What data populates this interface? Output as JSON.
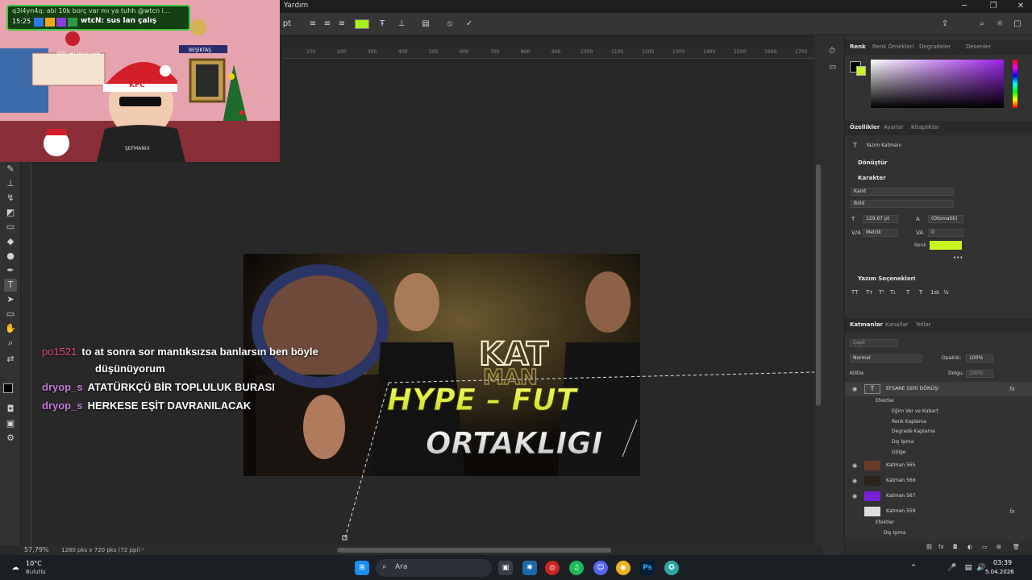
{
  "menubar": {
    "help_label": "Yardım"
  },
  "options_bar": {
    "unit": "pt",
    "text_color": "#a8f01a"
  },
  "webcam_overlay": {
    "chat_top_line1": "q3l4yn4q: abi 10k borç var mı ya tuhh @wtcn i...",
    "chat_top_time": "15:25",
    "chat_top_line2": "wtcN: sus lan çalış",
    "sign_text": "BEŞİKTAŞ",
    "hat_text": "KFC",
    "small_text": "4656 sen kimsin yaze",
    "shirt_text": "ŞEFMANIX"
  },
  "chat_overlay": [
    {
      "user": "po1521",
      "text": "to at sonra sor mantıksızsa banlarsın ben böyle",
      "cont": "düşünüyorum"
    },
    {
      "user": "dryop_s",
      "text": "ATATÜRKÇÜ BİR TOPLULUK BURASI"
    },
    {
      "user": "dryop_s",
      "text": "HERKESE EŞİT DAVRANILACAK"
    }
  ],
  "document": {
    "line1": "HYPE – FUT",
    "line2": "ORTAKLIGI",
    "neon_text": "KAT",
    "neon_text2": "MAN"
  },
  "ruler": {
    "ticks": [
      "100",
      "200",
      "300",
      "400",
      "500",
      "600",
      "700",
      "800",
      "900",
      "1000",
      "1100",
      "1200",
      "1300",
      "1400",
      "1500",
      "1600",
      "1700"
    ]
  },
  "status_bar": {
    "zoom": "57,79%",
    "doc_size": "1280 pks x 720 pks (72 ppi)"
  },
  "color_panel": {
    "tabs": [
      "Renk",
      "Renk Örnekleri",
      "Degradeler",
      "Desenler"
    ],
    "active_tab": "Renk"
  },
  "properties_panel": {
    "tabs": [
      "Özellikler",
      "Ayarlar",
      "Kitaplıklar"
    ],
    "layer_type": "Yazım Katmanı",
    "section_transform": "Dönüştür",
    "section_character": "Karakter",
    "font_family": "Kanit",
    "font_style": "Bold",
    "font_size": "129,67 pt",
    "leading": "(Otomatik)",
    "kerning": "Metrik",
    "tracking": "0",
    "color_label": "Renk",
    "color_value": "#c8f520",
    "section_typography": "Yazım Seçenekleri",
    "type_buttons": [
      "TT",
      "Tт",
      "T¹",
      "T₁",
      "T",
      "Ŧ",
      "1st",
      "½"
    ]
  },
  "layers_panel": {
    "tabs": [
      "Katmanlar",
      "Kanallar",
      "Yollar"
    ],
    "search_placeholder": "Çeşit",
    "blend_mode": "Normal",
    "opacity_label": "Opaklık:",
    "opacity_value": "100%",
    "lock_label": "Kilitle:",
    "fill_label": "Dolgu:",
    "fill_value": "100%",
    "layers": [
      {
        "name": "EFSANE GERİ DÖNÜŞ!",
        "type": "text",
        "fx": true,
        "visible": true
      },
      {
        "name": "Katman 565",
        "type": "image",
        "fx": false,
        "visible": true
      },
      {
        "name": "Katman 566",
        "type": "image",
        "fx": false,
        "visible": true
      },
      {
        "name": "Katman 567",
        "type": "image",
        "fx": false,
        "visible": true
      },
      {
        "name": "Katman 559",
        "type": "image",
        "fx": true,
        "visible": false
      }
    ],
    "effects_label": "Efektler",
    "effects1": [
      "Eğim Ver ve Kabart",
      "Renk Kaplama",
      "Degrade Kaplama",
      "Dış Işıma",
      "Gölge"
    ],
    "effects2": [
      "Dış Işıma"
    ],
    "fx_symbol": "fx"
  },
  "taskbar": {
    "weather_temp": "10°C",
    "weather_desc": "Bulutlu",
    "search_placeholder": "Ara",
    "time": "03:39",
    "date": "5.04.2026"
  }
}
